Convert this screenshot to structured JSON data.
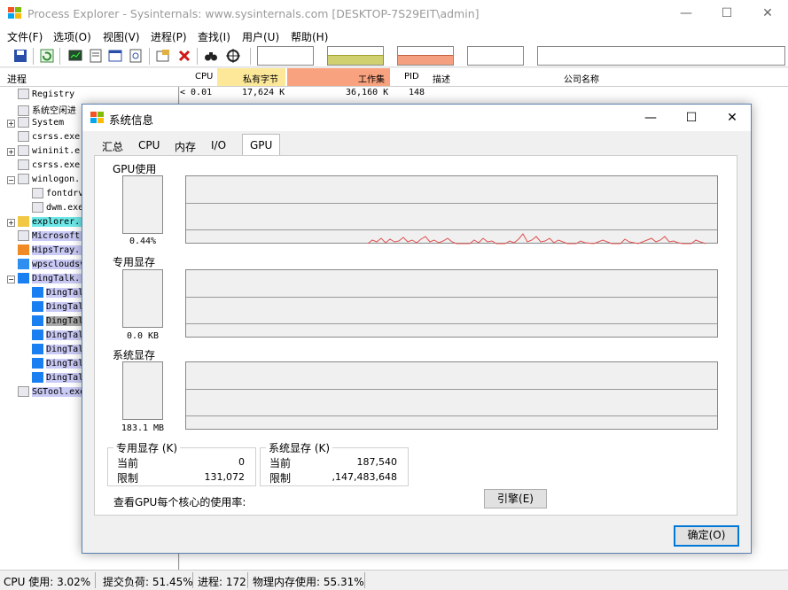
{
  "app": {
    "title": "Process Explorer - Sysinternals: www.sysinternals.com [DESKTOP-7S29EIT\\admin]",
    "min": "—",
    "max": "☐",
    "close": "✕"
  },
  "menu": [
    "文件(F)",
    "选项(O)",
    "视图(V)",
    "进程(P)",
    "查找(I)",
    "用户(U)",
    "帮助(H)"
  ],
  "columns": {
    "process": "进程",
    "cpu": "CPU",
    "private": "私有字节",
    "working": "工作集",
    "pid": "PID",
    "desc": "描述",
    "company": "公司名称"
  },
  "first_row": {
    "cpu": "< 0.01",
    "private": "17,624 K",
    "working": "36,160 K",
    "pid": "148"
  },
  "processes": [
    {
      "name": "Registry"
    },
    {
      "name": "系统空闲进"
    },
    {
      "name": "System"
    },
    {
      "name": "csrss.exe"
    },
    {
      "name": "wininit.e"
    },
    {
      "name": "csrss.exe"
    },
    {
      "name": "winlogon."
    },
    {
      "name": "fontdrv"
    },
    {
      "name": "dwm.exe"
    },
    {
      "name": "explorer."
    },
    {
      "name": "Microsoft"
    },
    {
      "name": "HipsTray."
    },
    {
      "name": "wpscloudsv"
    },
    {
      "name": "DingTalk."
    },
    {
      "name": "DingTal"
    },
    {
      "name": "DingTal"
    },
    {
      "name": "DingTal"
    },
    {
      "name": "DingTal"
    },
    {
      "name": "DingTal"
    },
    {
      "name": "DingTal"
    },
    {
      "name": "DingTal"
    },
    {
      "name": "SGTool.exe"
    }
  ],
  "status": {
    "cpu": "CPU 使用: 3.02%",
    "commit": "提交负荷: 51.45%",
    "procs": "进程: 172",
    "mem": "物理内存使用: 55.31%"
  },
  "dialog": {
    "title": "系统信息",
    "tabs": [
      "汇总",
      "CPU",
      "内存",
      "I/O",
      "GPU"
    ],
    "active_tab": "GPU",
    "gpu_usage_label": "GPU使用",
    "gpu_usage_value": "0.44%",
    "dedicated_label": "专用显存",
    "dedicated_value": "0.0 KB",
    "system_label": "系统显存",
    "system_value": "183.1 MB",
    "group_dedicated": {
      "title": "专用显存 (K)",
      "current_label": "当前",
      "current": "0",
      "limit_label": "限制",
      "limit": "131,072"
    },
    "group_system": {
      "title": "系统显存 (K)",
      "current_label": "当前",
      "current": "187,540",
      "limit_label": "限制",
      "limit": ",147,483,648"
    },
    "percore_label": "查看GPU每个核心的使用率:",
    "engine_button": "引擎(E)",
    "ok_button": "确定(O)"
  },
  "colors": {
    "accent": "#0078d7",
    "private_hdr": "#fde89a",
    "working_hdr": "#f9a27f",
    "explorer_row": "#6ee8e8",
    "service_row": "#c9c9f5",
    "gpu_line": "#e05050"
  }
}
